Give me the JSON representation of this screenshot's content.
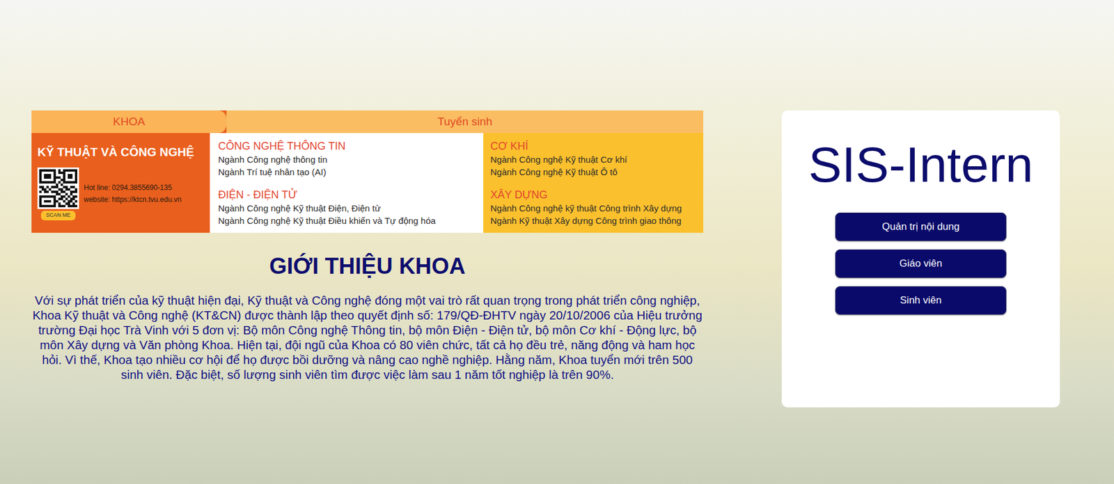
{
  "banner": {
    "tab": "KHOA",
    "header": "Tuyển sinh",
    "faculty": "KỸ THUẬT VÀ CÔNG NGHỆ",
    "hotline": "Hot line: 0294.3855690-135",
    "website": "website: https://ktcn.tvu.edu.vn",
    "scan": "SCAN ME",
    "columns": [
      {
        "groups": [
          {
            "title": "CÔNG NGHỆ THÔNG TIN",
            "majors": [
              "Ngành Công nghệ thông tin",
              "Ngành Trí tuệ nhân tạo (AI)"
            ]
          },
          {
            "title": "ĐIỆN - ĐIỆN TỬ",
            "majors": [
              "Ngành Công nghệ Kỹ thuật Điện, Điện tử",
              "Ngành Công nghệ Kỹ thuật Điều khiển và Tự động hóa"
            ]
          }
        ]
      },
      {
        "groups": [
          {
            "title": "CƠ KHÍ",
            "majors": [
              "Ngành Công nghệ Kỹ thuật Cơ khí",
              "Ngành Công nghệ Kỹ thuật Ô tô"
            ]
          },
          {
            "title": "XÂY DỰNG",
            "majors": [
              "Ngành Công nghệ kỹ thuật Công trình Xây dựng",
              "Ngành Kỹ thuật Xây dựng Công trình giao thông"
            ]
          }
        ]
      }
    ]
  },
  "intro": {
    "title": "GIỚI THIỆU KHOA",
    "text": "Với sự phát triển của kỹ thuật hiện đại, Kỹ thuật và Công nghệ đóng một vai trò rất quan trọng trong phát triển công nghiệp, Khoa Kỹ thuật và Công nghệ (KT&CN) được thành lập theo quyết định số: 179/QĐ-ĐHTV ngày 20/10/2006 của Hiệu trưởng trường Đại học Trà Vinh với 5 đơn vị: Bộ môn Công nghệ Thông tin, bộ môn Điện - Điện tử, bộ môn Cơ khí - Động lực, bộ môn Xây dựng và Văn phòng Khoa. Hiện tại, đội ngũ của Khoa có 80 viên chức, tất cả họ đều trẻ, năng động và ham học hỏi. Vì thế, Khoa tạo nhiều cơ hội để họ được bồi dưỡng và nâng cao nghề nghiệp. Hằng năm, Khoa tuyển mới trên 500 sinh viên. Đặc biệt, số lượng sinh viên tìm được việc làm sau 1 năm tốt nghiệp là trên 90%."
  },
  "login": {
    "title": "SIS-Intern",
    "buttons": [
      "Quản trị nội dung",
      "Giáo viên",
      "Sinh viên"
    ]
  }
}
